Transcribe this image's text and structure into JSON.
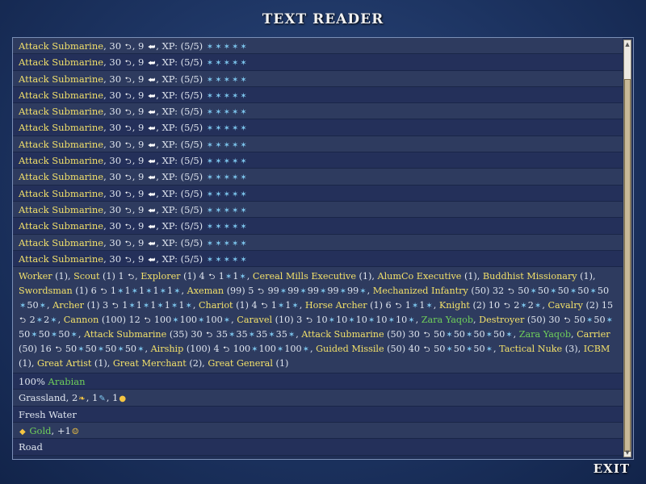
{
  "window": {
    "title": "TEXT READER",
    "exit_label": "EXIT"
  },
  "submarine_row": {
    "name": "Attack Submarine",
    "strength": "30",
    "moves": "9",
    "xp_label": "XP: (5/5)"
  },
  "submarine_row_count": 14,
  "unit_list": {
    "segments": [
      [
        "y",
        "Worker"
      ],
      [
        "w",
        " (1), "
      ],
      [
        "y",
        "Scout"
      ],
      [
        "w",
        " (1) 1 "
      ],
      [
        "ic",
        "fist"
      ],
      [
        "w",
        ", "
      ],
      [
        "y",
        "Explorer"
      ],
      [
        "w",
        " (1) 4 "
      ],
      [
        "ic",
        "fist"
      ],
      [
        "w",
        " 1"
      ],
      [
        "ic",
        "promo"
      ],
      [
        "w",
        "1"
      ],
      [
        "ic",
        "promo"
      ],
      [
        "w",
        ", "
      ],
      [
        "y",
        "Cereal Mills Executive"
      ],
      [
        "w",
        " (1), "
      ],
      [
        "y",
        "AlumCo Executive"
      ],
      [
        "w",
        " (1), "
      ],
      [
        "y",
        "Buddhist Missionary"
      ],
      [
        "w",
        " (1), "
      ],
      [
        "y",
        "Swordsman"
      ],
      [
        "w",
        " (1) 6 "
      ],
      [
        "ic",
        "fist"
      ],
      [
        "w",
        " 1"
      ],
      [
        "ic",
        "promo"
      ],
      [
        "w",
        "1"
      ],
      [
        "ic",
        "promo"
      ],
      [
        "w",
        "1"
      ],
      [
        "ic",
        "promo"
      ],
      [
        "w",
        "1"
      ],
      [
        "ic",
        "promo"
      ],
      [
        "w",
        "1"
      ],
      [
        "ic",
        "promo"
      ],
      [
        "w",
        ", "
      ],
      [
        "y",
        "Axeman"
      ],
      [
        "w",
        " (99) 5 "
      ],
      [
        "ic",
        "fist"
      ],
      [
        "w",
        " 99"
      ],
      [
        "ic",
        "promo"
      ],
      [
        "w",
        "99"
      ],
      [
        "ic",
        "promo"
      ],
      [
        "w",
        "99"
      ],
      [
        "ic",
        "promo"
      ],
      [
        "w",
        "99"
      ],
      [
        "ic",
        "promo"
      ],
      [
        "w",
        "99"
      ],
      [
        "ic",
        "promo"
      ],
      [
        "w",
        ", "
      ],
      [
        "y",
        "Mechanized Infantry"
      ],
      [
        "w",
        " (50) 32 "
      ],
      [
        "ic",
        "fist"
      ],
      [
        "w",
        " 50"
      ],
      [
        "ic",
        "promo"
      ],
      [
        "w",
        "50"
      ],
      [
        "ic",
        "promo"
      ],
      [
        "w",
        "50"
      ],
      [
        "ic",
        "promo"
      ],
      [
        "w",
        "50"
      ],
      [
        "ic",
        "promo"
      ],
      [
        "w",
        "50"
      ],
      [
        "ic",
        "promo"
      ],
      [
        "w",
        "50"
      ],
      [
        "ic",
        "promo"
      ],
      [
        "w",
        ", "
      ],
      [
        "y",
        "Archer"
      ],
      [
        "w",
        " (1) 3 "
      ],
      [
        "ic",
        "fist"
      ],
      [
        "w",
        " 1"
      ],
      [
        "ic",
        "promo"
      ],
      [
        "w",
        "1"
      ],
      [
        "ic",
        "promo"
      ],
      [
        "w",
        "1"
      ],
      [
        "ic",
        "promo"
      ],
      [
        "w",
        "1"
      ],
      [
        "ic",
        "promo"
      ],
      [
        "w",
        "1"
      ],
      [
        "ic",
        "promo"
      ],
      [
        "w",
        ", "
      ],
      [
        "y",
        "Chariot"
      ],
      [
        "w",
        " (1) 4 "
      ],
      [
        "ic",
        "fist"
      ],
      [
        "w",
        " 1"
      ],
      [
        "ic",
        "promo"
      ],
      [
        "w",
        "1"
      ],
      [
        "ic",
        "promo"
      ],
      [
        "w",
        ", "
      ],
      [
        "y",
        "Horse Archer"
      ],
      [
        "w",
        " (1) 6 "
      ],
      [
        "ic",
        "fist"
      ],
      [
        "w",
        " 1"
      ],
      [
        "ic",
        "promo"
      ],
      [
        "w",
        "1"
      ],
      [
        "ic",
        "promo"
      ],
      [
        "w",
        ", "
      ],
      [
        "y",
        "Knight"
      ],
      [
        "w",
        " (2) 10 "
      ],
      [
        "ic",
        "fist"
      ],
      [
        "w",
        " 2"
      ],
      [
        "ic",
        "promo"
      ],
      [
        "w",
        "2"
      ],
      [
        "ic",
        "promo"
      ],
      [
        "w",
        ", "
      ],
      [
        "y",
        "Cavalry"
      ],
      [
        "w",
        " (2) 15 "
      ],
      [
        "ic",
        "fist"
      ],
      [
        "w",
        " 2"
      ],
      [
        "ic",
        "promo"
      ],
      [
        "w",
        "2"
      ],
      [
        "ic",
        "promo"
      ],
      [
        "w",
        ", "
      ],
      [
        "y",
        "Cannon"
      ],
      [
        "w",
        " (100) 12 "
      ],
      [
        "ic",
        "fist"
      ],
      [
        "w",
        " 100"
      ],
      [
        "ic",
        "promo"
      ],
      [
        "w",
        "100"
      ],
      [
        "ic",
        "promo"
      ],
      [
        "w",
        "100"
      ],
      [
        "ic",
        "promo"
      ],
      [
        "w",
        ", "
      ],
      [
        "y",
        "Caravel"
      ],
      [
        "w",
        " (10) 3 "
      ],
      [
        "ic",
        "fist"
      ],
      [
        "w",
        " 10"
      ],
      [
        "ic",
        "promo"
      ],
      [
        "w",
        "10"
      ],
      [
        "ic",
        "promo"
      ],
      [
        "w",
        "10"
      ],
      [
        "ic",
        "promo"
      ],
      [
        "w",
        "10"
      ],
      [
        "ic",
        "promo"
      ],
      [
        "w",
        "10"
      ],
      [
        "ic",
        "promo"
      ],
      [
        "w",
        ", "
      ],
      [
        "g",
        "Zara Yaqob"
      ],
      [
        "w",
        ", "
      ],
      [
        "y",
        "Destroyer"
      ],
      [
        "w",
        " (50) 30 "
      ],
      [
        "ic",
        "fist"
      ],
      [
        "w",
        " 50"
      ],
      [
        "ic",
        "promo"
      ],
      [
        "w",
        "50"
      ],
      [
        "ic",
        "promo"
      ],
      [
        "w",
        "50"
      ],
      [
        "ic",
        "promo"
      ],
      [
        "w",
        "50"
      ],
      [
        "ic",
        "promo"
      ],
      [
        "w",
        "50"
      ],
      [
        "ic",
        "promo"
      ],
      [
        "w",
        ", "
      ],
      [
        "y",
        "Attack Submarine"
      ],
      [
        "w",
        " (35) 30 "
      ],
      [
        "ic",
        "fist"
      ],
      [
        "w",
        " 35"
      ],
      [
        "ic",
        "promo"
      ],
      [
        "w",
        "35"
      ],
      [
        "ic",
        "promo"
      ],
      [
        "w",
        "35"
      ],
      [
        "ic",
        "promo"
      ],
      [
        "w",
        "35"
      ],
      [
        "ic",
        "promo"
      ],
      [
        "w",
        ", "
      ],
      [
        "y",
        "Attack Submarine"
      ],
      [
        "w",
        " (50) 30 "
      ],
      [
        "ic",
        "fist"
      ],
      [
        "w",
        " 50"
      ],
      [
        "ic",
        "promo"
      ],
      [
        "w",
        "50"
      ],
      [
        "ic",
        "promo"
      ],
      [
        "w",
        "50"
      ],
      [
        "ic",
        "promo"
      ],
      [
        "w",
        "50"
      ],
      [
        "ic",
        "promo"
      ],
      [
        "w",
        ", "
      ],
      [
        "g",
        "Zara Yaqob"
      ],
      [
        "w",
        ", "
      ],
      [
        "y",
        "Carrier"
      ],
      [
        "w",
        " (50) 16 "
      ],
      [
        "ic",
        "fist"
      ],
      [
        "w",
        " 50"
      ],
      [
        "ic",
        "promo"
      ],
      [
        "w",
        "50"
      ],
      [
        "ic",
        "promo"
      ],
      [
        "w",
        "50"
      ],
      [
        "ic",
        "promo"
      ],
      [
        "w",
        "50"
      ],
      [
        "ic",
        "promo"
      ],
      [
        "w",
        ", "
      ],
      [
        "y",
        "Airship"
      ],
      [
        "w",
        " (100) 4 "
      ],
      [
        "ic",
        "fist"
      ],
      [
        "w",
        " 100"
      ],
      [
        "ic",
        "promo"
      ],
      [
        "w",
        "100"
      ],
      [
        "ic",
        "promo"
      ],
      [
        "w",
        "100"
      ],
      [
        "ic",
        "promo"
      ],
      [
        "w",
        ", "
      ],
      [
        "y",
        "Guided Missile"
      ],
      [
        "w",
        " (50) 40 "
      ],
      [
        "ic",
        "fist"
      ],
      [
        "w",
        " 50"
      ],
      [
        "ic",
        "promo"
      ],
      [
        "w",
        "50"
      ],
      [
        "ic",
        "promo"
      ],
      [
        "w",
        "50"
      ],
      [
        "ic",
        "promo"
      ],
      [
        "w",
        ", "
      ],
      [
        "y",
        "Tactical Nuke"
      ],
      [
        "w",
        " (3), "
      ],
      [
        "y",
        "ICBM"
      ],
      [
        "w",
        " (1), "
      ],
      [
        "y",
        "Great Artist"
      ],
      [
        "w",
        " (1), "
      ],
      [
        "y",
        "Great Merchant"
      ],
      [
        "w",
        " (2), "
      ],
      [
        "y",
        "Great General"
      ],
      [
        "w",
        " (1)"
      ]
    ]
  },
  "culture_row": {
    "percent": "100%",
    "civ": "Arabian"
  },
  "terrain_row": {
    "name": "Grassland",
    "food": "2",
    "production": "1",
    "commerce": "1"
  },
  "feature_row": {
    "text": "Fresh Water"
  },
  "resource_row": {
    "name": "Gold",
    "bonus": "+1"
  },
  "route_row": {
    "text": "Road"
  },
  "icons": {
    "fist": "strength-icon",
    "moves": "movement-icon",
    "promo": "promotion-icon",
    "food": "food-icon",
    "hammer": "production-icon",
    "coin": "commerce-icon",
    "smile": "happy-icon",
    "gold": "gold-resource-icon"
  },
  "colors": {
    "unit_name": "#f2e06a",
    "leader_name": "#6fcf5a",
    "panel_bg": "#1f2e55"
  }
}
